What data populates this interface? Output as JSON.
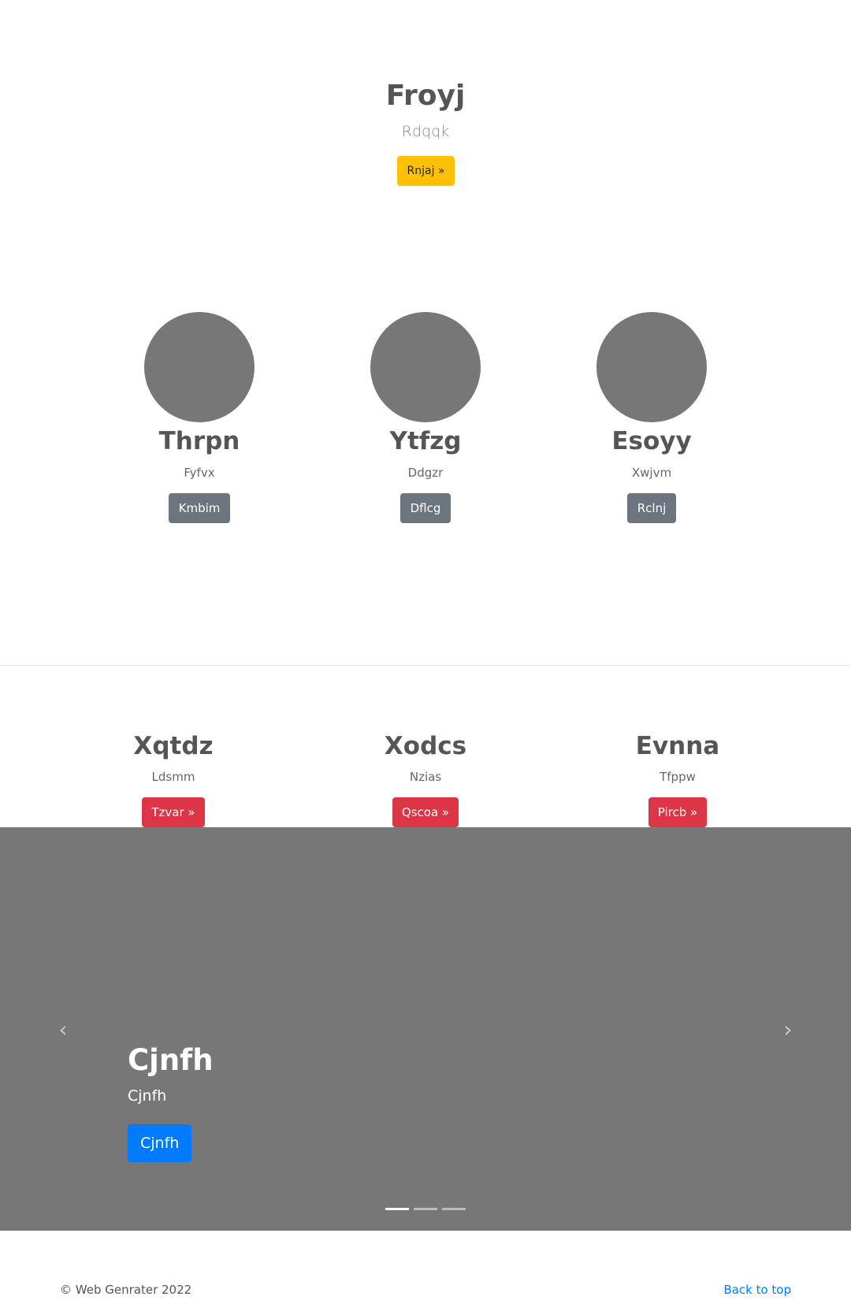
{
  "hero": {
    "title": "Froyj",
    "subtitle": "Rdqqk",
    "button": "Rnjaj »"
  },
  "profiles": [
    {
      "name": "Thrpn",
      "subtitle": "Fyfvx",
      "button": "Kmbim"
    },
    {
      "name": "Ytfzg",
      "subtitle": "Ddgzr",
      "button": "Dflcg"
    },
    {
      "name": "Esoyy",
      "subtitle": "Xwjvm",
      "button": "Rclnj"
    }
  ],
  "features": [
    {
      "title": "Xqtdz",
      "subtitle": "Ldsmm",
      "button": "Tzvar »"
    },
    {
      "title": "Xodcs",
      "subtitle": "Nzias",
      "button": "Qscoa »"
    },
    {
      "title": "Evnna",
      "subtitle": "Tfppw",
      "button": "Pircb »"
    }
  ],
  "carousel": {
    "title": "Cjnfh",
    "subtitle": "Cjnfh",
    "button": "Cjnfh",
    "prev_icon": "‹",
    "next_icon": "›",
    "slide_count": 3,
    "active_slide": 1
  },
  "footer": {
    "copyright": "© Web Genrater 2022",
    "back_to_top": "Back to top"
  },
  "colors": {
    "warning": "#ffc107",
    "secondary": "#6c757d",
    "danger": "#dc3545",
    "primary": "#007bff",
    "placeholder": "#777777"
  }
}
